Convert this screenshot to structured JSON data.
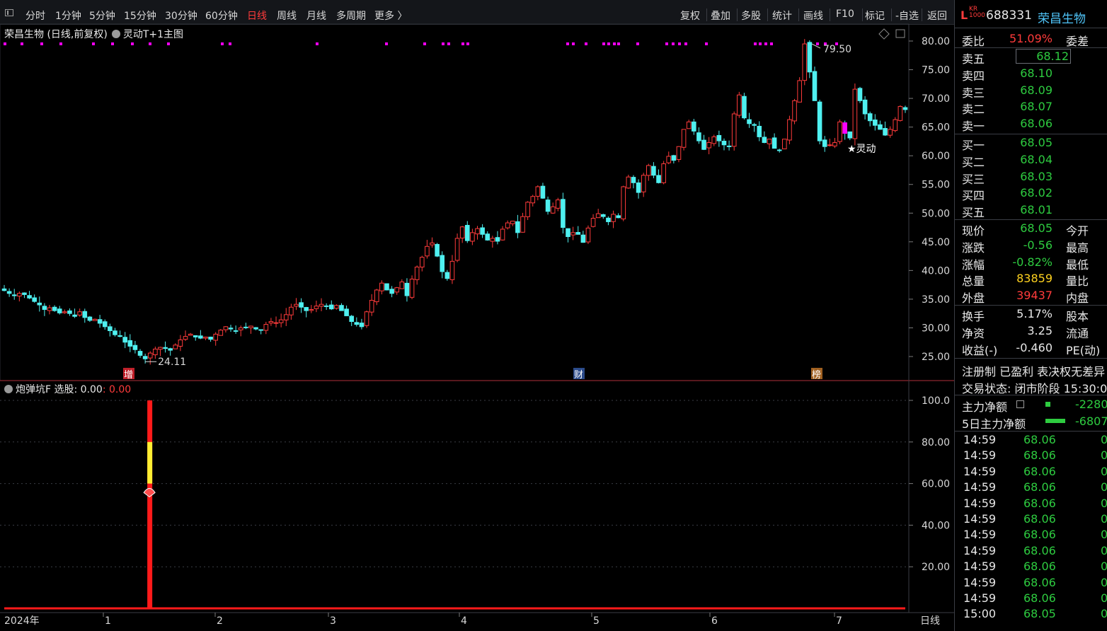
{
  "toolbar": {
    "periods": [
      "分时",
      "1分钟",
      "5分钟",
      "15分钟",
      "30分钟",
      "60分钟",
      "日线",
      "周线",
      "月线",
      "多周期",
      "更多 〉"
    ],
    "active_period": "日线",
    "tools": [
      "复权",
      "叠加",
      "多股",
      "统计",
      "画线",
      "F10",
      "标记",
      "-自选",
      "返回"
    ]
  },
  "main_chart": {
    "title": "荣昌生物 (日线,前复权)",
    "indicator": "灵动T+1主图",
    "y_ticks": [
      "80.00",
      "75.00",
      "70.00",
      "65.00",
      "60.00",
      "55.00",
      "50.00",
      "45.00",
      "40.00",
      "35.00",
      "30.00",
      "25.00"
    ],
    "high_label": "79.50",
    "low_label": "24.11",
    "signal_label": "★灵动",
    "events": [
      "增",
      "财",
      "榜"
    ]
  },
  "sub_chart": {
    "title": "炮弹坑F 选股: 0.00",
    "value_red": ": 0.00",
    "y_ticks": [
      "100.0",
      "80.00",
      "60.00",
      "40.00",
      "20.00"
    ]
  },
  "x_axis": {
    "year": "2024年",
    "months": [
      "1",
      "2",
      "3",
      "4",
      "5",
      "6",
      "7"
    ],
    "period_label": "日线"
  },
  "quote": {
    "market": "L",
    "badge": "KR\n1000",
    "code": "688331",
    "name": "荣昌生物",
    "weibi_label": "委比",
    "weibi": "51.09%",
    "weicha_label": "委差",
    "asks": [
      {
        "label": "卖五",
        "price": "68.12"
      },
      {
        "label": "卖四",
        "price": "68.10"
      },
      {
        "label": "卖三",
        "price": "68.09"
      },
      {
        "label": "卖二",
        "price": "68.07"
      },
      {
        "label": "卖一",
        "price": "68.06"
      }
    ],
    "bids": [
      {
        "label": "买一",
        "price": "68.05"
      },
      {
        "label": "买二",
        "price": "68.04"
      },
      {
        "label": "买三",
        "price": "68.03"
      },
      {
        "label": "买四",
        "price": "68.02"
      },
      {
        "label": "买五",
        "price": "68.01"
      }
    ],
    "stats": [
      {
        "label": "现价",
        "value": "68.05",
        "right": "今开",
        "color": "green"
      },
      {
        "label": "涨跌",
        "value": "-0.56",
        "right": "最高",
        "color": "green"
      },
      {
        "label": "涨幅",
        "value": "-0.82%",
        "right": "最低",
        "color": "green"
      },
      {
        "label": "总量",
        "value": "83859",
        "right": "量比",
        "color": "yellow"
      },
      {
        "label": "外盘",
        "value": "39437",
        "right": "内盘",
        "color": "red"
      }
    ],
    "stats2": [
      {
        "label": "换手",
        "value": "5.17%",
        "right": "股本"
      },
      {
        "label": "净资",
        "value": "3.25",
        "right": "流通"
      },
      {
        "label": "收益(-)",
        "value": "-0.460",
        "right": "PE(动)"
      }
    ],
    "flags": "注册制 已盈利 表决权无差异",
    "status": "交易状态: 闭市阶段 15:30:00",
    "main_flow_label": "主力净额",
    "main_flow_value": "-2280",
    "flow5_label": "5日主力净额",
    "flow5_value": "-6807"
  },
  "trades": [
    {
      "time": "14:59",
      "price": "68.06",
      "vol": "0"
    },
    {
      "time": "14:59",
      "price": "68.06",
      "vol": "0"
    },
    {
      "time": "14:59",
      "price": "68.06",
      "vol": "0"
    },
    {
      "time": "14:59",
      "price": "68.06",
      "vol": "0"
    },
    {
      "time": "14:59",
      "price": "68.06",
      "vol": "0"
    },
    {
      "time": "14:59",
      "price": "68.06",
      "vol": "0"
    },
    {
      "time": "14:59",
      "price": "68.06",
      "vol": "0"
    },
    {
      "time": "14:59",
      "price": "68.06",
      "vol": "0"
    },
    {
      "time": "14:59",
      "price": "68.06",
      "vol": "0"
    },
    {
      "time": "14:59",
      "price": "68.06",
      "vol": "0"
    },
    {
      "time": "14:59",
      "price": "68.06",
      "vol": "0"
    },
    {
      "time": "15:00",
      "price": "68.05",
      "vol": "0"
    }
  ],
  "colors": {
    "up": "#ff3b3b",
    "down": "#4ff0f0",
    "signal": "#ff00ff",
    "bg": "#000000"
  },
  "chart_data": {
    "type": "candlestick",
    "ylim": [
      23,
      82
    ],
    "closes": [
      36.5,
      36,
      35.6,
      36,
      35.8,
      35.2,
      34.6,
      34,
      33.2,
      33.5,
      33,
      32.6,
      32.8,
      32.5,
      32,
      32.8,
      31.8,
      31.3,
      31.5,
      30.8,
      30.2,
      29.5,
      28.8,
      28.5,
      27.5,
      26.8,
      26.2,
      25.2,
      24.6,
      25.6,
      26.3,
      26.6,
      26.4,
      26.1,
      27,
      27.9,
      28.5,
      28.9,
      28.4,
      28.2,
      28.4,
      28,
      28.9,
      29.6,
      30.2,
      29.8,
      29.5,
      30,
      30.1,
      30.3,
      29.8,
      29.6,
      30.6,
      31.1,
      30.9,
      31.4,
      32.3,
      33.6,
      34.1,
      33.6,
      33,
      33.2,
      33.8,
      34.1,
      33.7,
      33.3,
      33.9,
      33,
      32.1,
      31.1,
      30.6,
      30.2,
      32.8,
      34.8,
      36.6,
      37.8,
      36.6,
      36,
      37,
      38,
      35.6,
      38.5,
      40.6,
      42.3,
      44.2,
      44.8,
      42.5,
      39.8,
      38.6,
      41.6,
      45.6,
      47.6,
      45.2,
      46.6,
      47.3,
      46.3,
      45.3,
      45.6,
      45.1,
      47.2,
      48.3,
      48.6,
      46.6,
      49.4,
      51.9,
      52.9,
      54.6,
      52.6,
      50.3,
      51.1,
      52.3,
      47.5,
      45.9,
      46.6,
      46.3,
      44.9,
      47.4,
      49.1,
      49.9,
      49.4,
      48.5,
      49.8,
      49.2,
      54.6,
      56.3,
      55.3,
      53.6,
      56.6,
      58.3,
      56.6,
      55.3,
      58.6,
      59.9,
      59.2,
      61.6,
      64.6,
      65.9,
      64.3,
      62.6,
      61.1,
      62.3,
      63.3,
      62.6,
      61.9,
      61.6,
      67.3,
      70.6,
      66.6,
      65.6,
      65.3,
      63.3,
      62.3,
      62.9,
      61.3,
      60.9,
      62.9,
      66.3,
      69.6,
      73.1,
      79.5,
      74.6,
      69.6,
      62.6,
      61.6,
      61.9,
      62.3,
      65.9,
      63.9,
      63.1,
      71.6,
      69.6,
      67.3,
      66.1,
      65.3,
      64.6,
      63.6,
      64.6,
      66.3,
      68.6,
      68.05
    ],
    "sub_series": {
      "name": "炮弹坑F",
      "spike_index": 28,
      "spike_value": 100,
      "signal_value": 57
    }
  }
}
